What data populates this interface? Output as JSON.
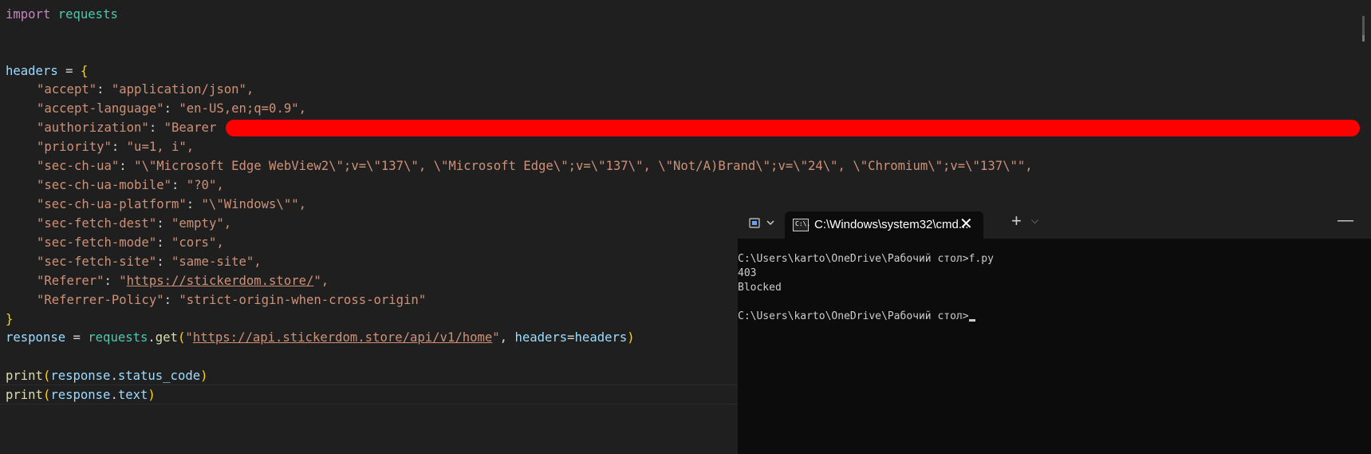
{
  "editor": {
    "line1": {
      "kw": "import",
      "module": "requests"
    },
    "headers_var": "headers",
    "assign": " = ",
    "open_brace": "{",
    "close_brace": "}",
    "entries": [
      {
        "key": "\"accept\"",
        "value": "\"application/json\","
      },
      {
        "key": "\"accept-language\"",
        "value": "\"en-US,en;q=0.9\","
      },
      {
        "key": "\"authorization\"",
        "value": "\"Bearer"
      },
      {
        "key": "\"priority\"",
        "value": "\"u=1, i\","
      },
      {
        "key": "\"sec-ch-ua\"",
        "value": "\"\\\"Microsoft Edge WebView2\\\";v=\\\"137\\\", \\\"Microsoft Edge\\\";v=\\\"137\\\", \\\"Not/A)Brand\\\";v=\\\"24\\\", \\\"Chromium\\\";v=\\\"137\\\"\","
      },
      {
        "key": "\"sec-ch-ua-mobile\"",
        "value": "\"?0\","
      },
      {
        "key": "\"sec-ch-ua-platform\"",
        "value": "\"\\\"Windows\\\"\","
      },
      {
        "key": "\"sec-fetch-dest\"",
        "value": "\"empty\","
      },
      {
        "key": "\"sec-fetch-mode\"",
        "value": "\"cors\","
      },
      {
        "key": "\"sec-fetch-site\"",
        "value": "\"same-site\","
      },
      {
        "key": "\"Referer\"",
        "q1": "\"",
        "url": "https://stickerdom.store/",
        "q2": "\","
      },
      {
        "key": "\"Referrer-Policy\"",
        "value": "\"strict-origin-when-cross-origin\""
      }
    ],
    "colon": ": ",
    "response_line": {
      "var": "response",
      "assign": " = ",
      "module": "requests",
      "dot": ".",
      "fn": "get",
      "open": "(",
      "q1": "\"",
      "url": "https://api.stickerdom.store/api/v1/home",
      "q2": "\"",
      "sep": ", ",
      "kwarg": "headers",
      "eq": "=",
      "arg": "headers",
      "close": ")"
    },
    "print1": {
      "fn": "print",
      "open": "(",
      "obj": "response",
      "dot": ".",
      "attr": "status_code",
      "close": ")"
    },
    "print2": {
      "fn": "print",
      "open": "(",
      "obj": "response",
      "dot": ".",
      "attr": "text",
      "close": ")"
    }
  },
  "terminal": {
    "tab_title": "C:\\Windows\\system32\\cmd...",
    "tab_icon_text": "C:\\.",
    "close_glyph": "✕",
    "new_tab_glyph": "+",
    "dropdown_glyph": "⌵",
    "minimize_glyph": "—",
    "lines": [
      "C:\\Users\\karto\\OneDrive\\Рабочий стол>f.py",
      "403",
      "Blocked",
      "",
      "C:\\Users\\karto\\OneDrive\\Рабочий стол>"
    ]
  },
  "colors": {
    "redaction": "#ff0000",
    "editor_bg": "#1f1f1f",
    "terminal_bg": "#0c0c0c"
  }
}
